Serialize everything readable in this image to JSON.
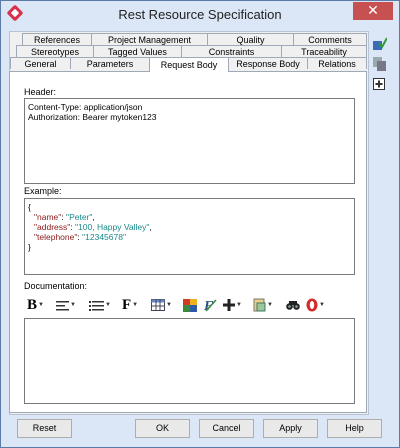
{
  "window": {
    "title": "Rest Resource Specification",
    "close_glyph": "✕"
  },
  "tabs": {
    "row1": [
      "References",
      "Project Management",
      "Quality",
      "Comments"
    ],
    "row2": [
      "Stereotypes",
      "Tagged Values",
      "Constraints",
      "Traceability"
    ],
    "row3": [
      "General",
      "Parameters",
      "Request Body",
      "Response Body",
      "Relations"
    ],
    "active": "Request Body"
  },
  "header": {
    "label": "Header:",
    "lines": [
      "Content-Type: application/json",
      "Authorization: Bearer mytoken123"
    ]
  },
  "example": {
    "label": "Example:",
    "open": "{",
    "close": "}",
    "fields": [
      {
        "key": "\"name\"",
        "sep": ": ",
        "value": "\"Peter\"",
        "end": ","
      },
      {
        "key": "\"address\"",
        "sep": ": ",
        "value": "\"100, Happy Valley\"",
        "end": ","
      },
      {
        "key": "\"telephone\"",
        "sep": ": ",
        "value": "\"12345678\"",
        "end": ""
      }
    ]
  },
  "documentation": {
    "label": "Documentation:",
    "value": "",
    "toolbar": [
      "bold-icon",
      "align-icon",
      "list-icon",
      "font-icon",
      "table-icon",
      "image-icon",
      "formula-icon",
      "add-icon",
      "paste-icon",
      "find-icon",
      "spell-check-icon"
    ]
  },
  "buttons": {
    "reset": "Reset",
    "ok": "OK",
    "cancel": "Cancel",
    "apply": "Apply",
    "help": "Help"
  },
  "colors": {
    "key": "#8b1a1a",
    "value": "#1a8a8a",
    "frame": "#dbe7f6",
    "close": "#c75050"
  }
}
